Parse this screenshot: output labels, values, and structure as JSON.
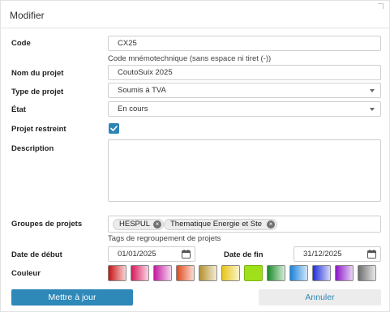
{
  "dialog": {
    "title": "Modifier"
  },
  "code": {
    "label": "Code",
    "value": "CX25",
    "hint": "Code mnémotechnique (sans espace ni tiret (-))"
  },
  "project_name": {
    "label": "Nom du projet",
    "value": "CoutoSuix 2025"
  },
  "project_type": {
    "label": "Type de projet",
    "value": "Soumis à TVA"
  },
  "state": {
    "label": "État",
    "value": "En cours"
  },
  "restricted": {
    "label": "Projet restreint",
    "checked": true
  },
  "description": {
    "label": "Description",
    "value": ""
  },
  "groups": {
    "label": "Groupes de projets",
    "tags": [
      {
        "label": "HESPUL"
      },
      {
        "label": "Thematique Energie et Ste"
      }
    ],
    "remove_glyph": "×",
    "hint": "Tags de regroupement de projets"
  },
  "start_date": {
    "label": "Date de début",
    "value": "01/01/2025"
  },
  "end_date": {
    "label": "Date de fin",
    "value": "31/12/2025"
  },
  "color": {
    "label": "Couleur",
    "swatches": [
      {
        "from": "#c91313",
        "to": "#f7d5d5"
      },
      {
        "from": "#d8175b",
        "to": "#f9d6e3"
      },
      {
        "from": "#c11a9e",
        "to": "#f5d6ee"
      },
      {
        "from": "#e0481d",
        "to": "#f9dcd2"
      },
      {
        "from": "#b3912e",
        "to": "#f3ecd6"
      },
      {
        "from": "#e7c51a",
        "to": "#fbf3cd"
      },
      {
        "from": "#9fe01a",
        "to": "#9fe01a"
      },
      {
        "from": "#1c8a2a",
        "to": "#d3ecd6"
      },
      {
        "from": "#1b82d8",
        "to": "#d3e7f8"
      },
      {
        "from": "#1f2fd8",
        "to": "#d3d6f8"
      },
      {
        "from": "#8a18c6",
        "to": "#e8d3f5"
      },
      {
        "from": "#6d6d6d",
        "to": "#e8e8e8"
      }
    ],
    "selected_index": 6
  },
  "actions": {
    "submit": "Mettre à jour",
    "cancel": "Annuler"
  },
  "colors": {
    "accent": "#2e88b8",
    "cancel_bg": "#ececec",
    "tag_bg": "#ececec"
  }
}
